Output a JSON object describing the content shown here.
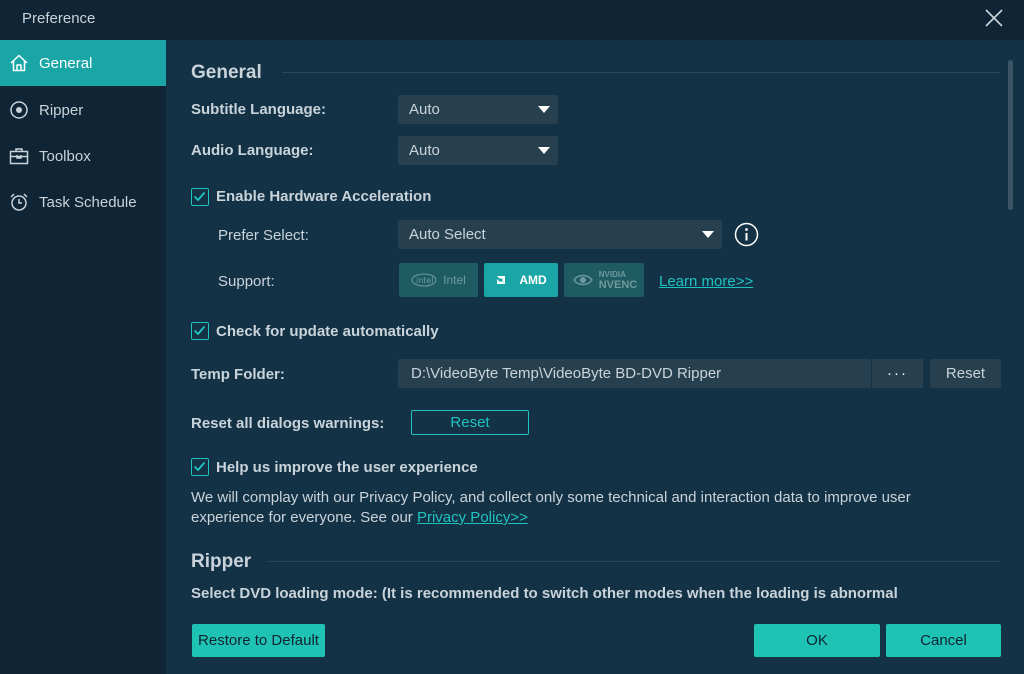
{
  "window": {
    "title": "Preference"
  },
  "sidebar": {
    "items": [
      {
        "label": "General",
        "icon": "home-icon",
        "active": true
      },
      {
        "label": "Ripper",
        "icon": "disc-icon",
        "active": false
      },
      {
        "label": "Toolbox",
        "icon": "toolbox-icon",
        "active": false
      },
      {
        "label": "Task Schedule",
        "icon": "alarm-clock-icon",
        "active": false
      }
    ]
  },
  "general": {
    "heading": "General",
    "subtitle_language": {
      "label": "Subtitle Language:",
      "value": "Auto"
    },
    "audio_language": {
      "label": "Audio Language:",
      "value": "Auto"
    },
    "hardware_acceleration": {
      "label": "Enable Hardware Acceleration",
      "checked": true
    },
    "prefer_select": {
      "label": "Prefer Select:",
      "value": "Auto Select"
    },
    "support": {
      "label": "Support:",
      "intel": "Intel",
      "amd": "AMD",
      "nvidia_top": "NVIDIA",
      "nvidia_bottom": "NVENC",
      "learn_more": "Learn more>>"
    },
    "check_update": {
      "label": "Check for update automatically",
      "checked": true
    },
    "temp_folder": {
      "label": "Temp Folder:",
      "path": "D:\\VideoByte Temp\\VideoByte BD-DVD Ripper",
      "browse": "···",
      "reset": "Reset"
    },
    "reset_dialogs": {
      "label": "Reset all dialogs warnings:",
      "button": "Reset"
    },
    "improve": {
      "label": "Help us improve the user experience",
      "checked": true,
      "text": "We will complay with our Privacy Policy, and collect only some technical and interaction data to improve user experience for everyone. See our ",
      "link": "Privacy Policy>>"
    }
  },
  "ripper": {
    "heading": "Ripper",
    "loading_mode": "Select DVD loading mode: (It is recommended to switch other modes when the loading is abnormal"
  },
  "footer": {
    "restore": "Restore to Default",
    "ok": "OK",
    "cancel": "Cancel"
  },
  "colors": {
    "accent": "#1aa6a6",
    "accent_bright": "#1ec3c0",
    "background": "#143246",
    "sidebar": "#0f2434"
  }
}
